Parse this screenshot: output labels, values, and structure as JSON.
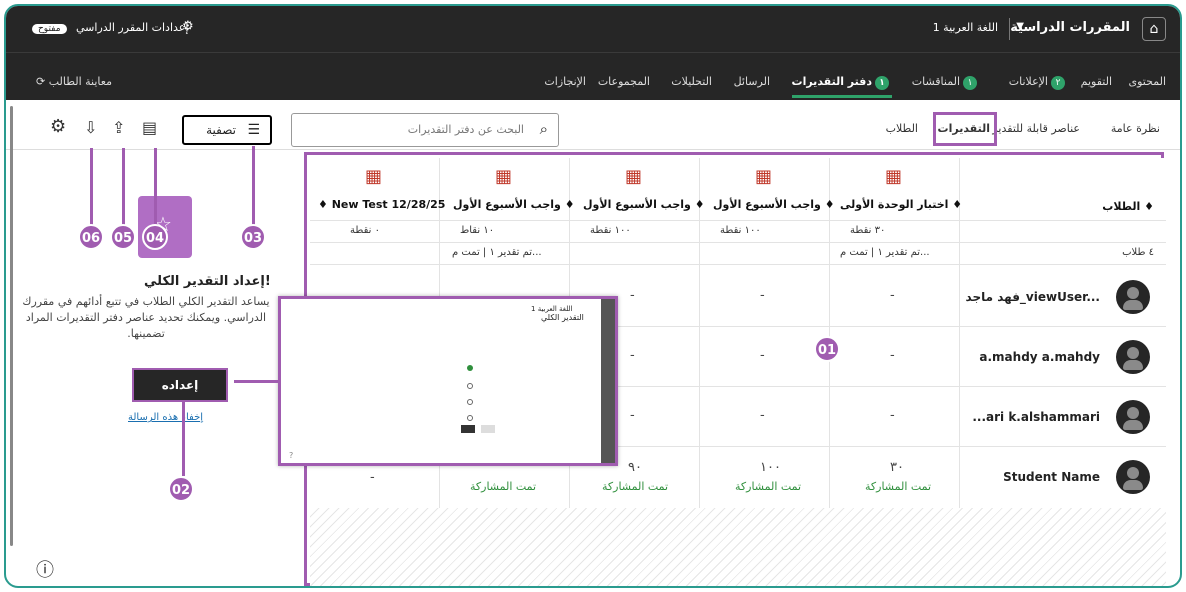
{
  "top": {
    "course_title": "المقررات الدراسية",
    "language": "اللغة العربية 1",
    "settings_label": "إعدادات المقرر الدراسي",
    "status_pill": "مفتوح",
    "student_preview": "معاينة الطالب"
  },
  "nav": {
    "items": [
      "المحتوى",
      "التقويم",
      "الإعلانات",
      "المناقشات",
      "دفتر التقديرات",
      "الرسائل",
      "التحليلات",
      "المجموعات",
      "الإنجازات"
    ],
    "badges": {
      "announcements": "٢",
      "discussions": "١",
      "gradebook": "١"
    }
  },
  "subtabs": [
    "نظرة عامة",
    "عناصر قابلة للتقدير",
    "التقديرات",
    "الطلاب"
  ],
  "search": {
    "placeholder": "البحث عن دفتر التقديرات"
  },
  "filter_label": "تصفية",
  "columns": [
    {
      "title": "الطلاب ♦",
      "points": "",
      "sub": "٤ طلاب"
    },
    {
      "title": "اختبار الوحدة الأولى ♦",
      "points": "٣٠ نقطة",
      "sub": "تم تقدير ١ | تمت م..."
    },
    {
      "title": "واجب الأسبوع الأول ♦",
      "points": "١٠٠ نقطة",
      "sub": ""
    },
    {
      "title": "واجب الأسبوع الأول ♦",
      "points": "١٠٠ نقطة",
      "sub": ""
    },
    {
      "title": "واجب الأسبوع الأول ♦",
      "points": "١٠ نقاط",
      "sub": "تم تقدير ١ | تمت م..."
    },
    {
      "title": "♦ New Test 12/28/25",
      "points": "٠ نقطة",
      "sub": ""
    }
  ],
  "students": [
    {
      "name": "فهد ماجد_viewUser...",
      "cells": [
        "-",
        "-",
        "-",
        "-",
        "-"
      ]
    },
    {
      "name": "a.mahdy a.mahdy",
      "cells": [
        "-",
        "-",
        "-",
        "",
        ""
      ]
    },
    {
      "name": "...ari k.alshammari",
      "cells": [
        "-",
        "-",
        "-",
        "",
        ""
      ]
    },
    {
      "name": "Student Name",
      "cells": [
        "٣٠",
        "١٠٠",
        "٩٠",
        "",
        ""
      ],
      "subs": [
        "تمت المشاركة",
        "تمت المشاركة",
        "تمت المشاركة",
        "تمت المشاركة"
      ]
    }
  ],
  "side": {
    "heading": "إعداد التقدير الكلي!",
    "body": "يساعد التقدير الكلي الطلاب في تتبع أدائهم في مقررك الدراسي. ويمكنك تحديد عناصر دفتر التقديرات المراد تضمينها.",
    "setup_button": "إعداده",
    "hide_link": "إخفاء هذه الرسالة"
  },
  "callouts": [
    "01",
    "02",
    "03",
    "04",
    "05",
    "06"
  ],
  "preview": {
    "title1": "اللغة العربية 1",
    "title2": "التقدير الكلي"
  },
  "colors": {
    "accent": "#a05cb0",
    "dark": "#262626",
    "green": "#2f8f3c"
  }
}
